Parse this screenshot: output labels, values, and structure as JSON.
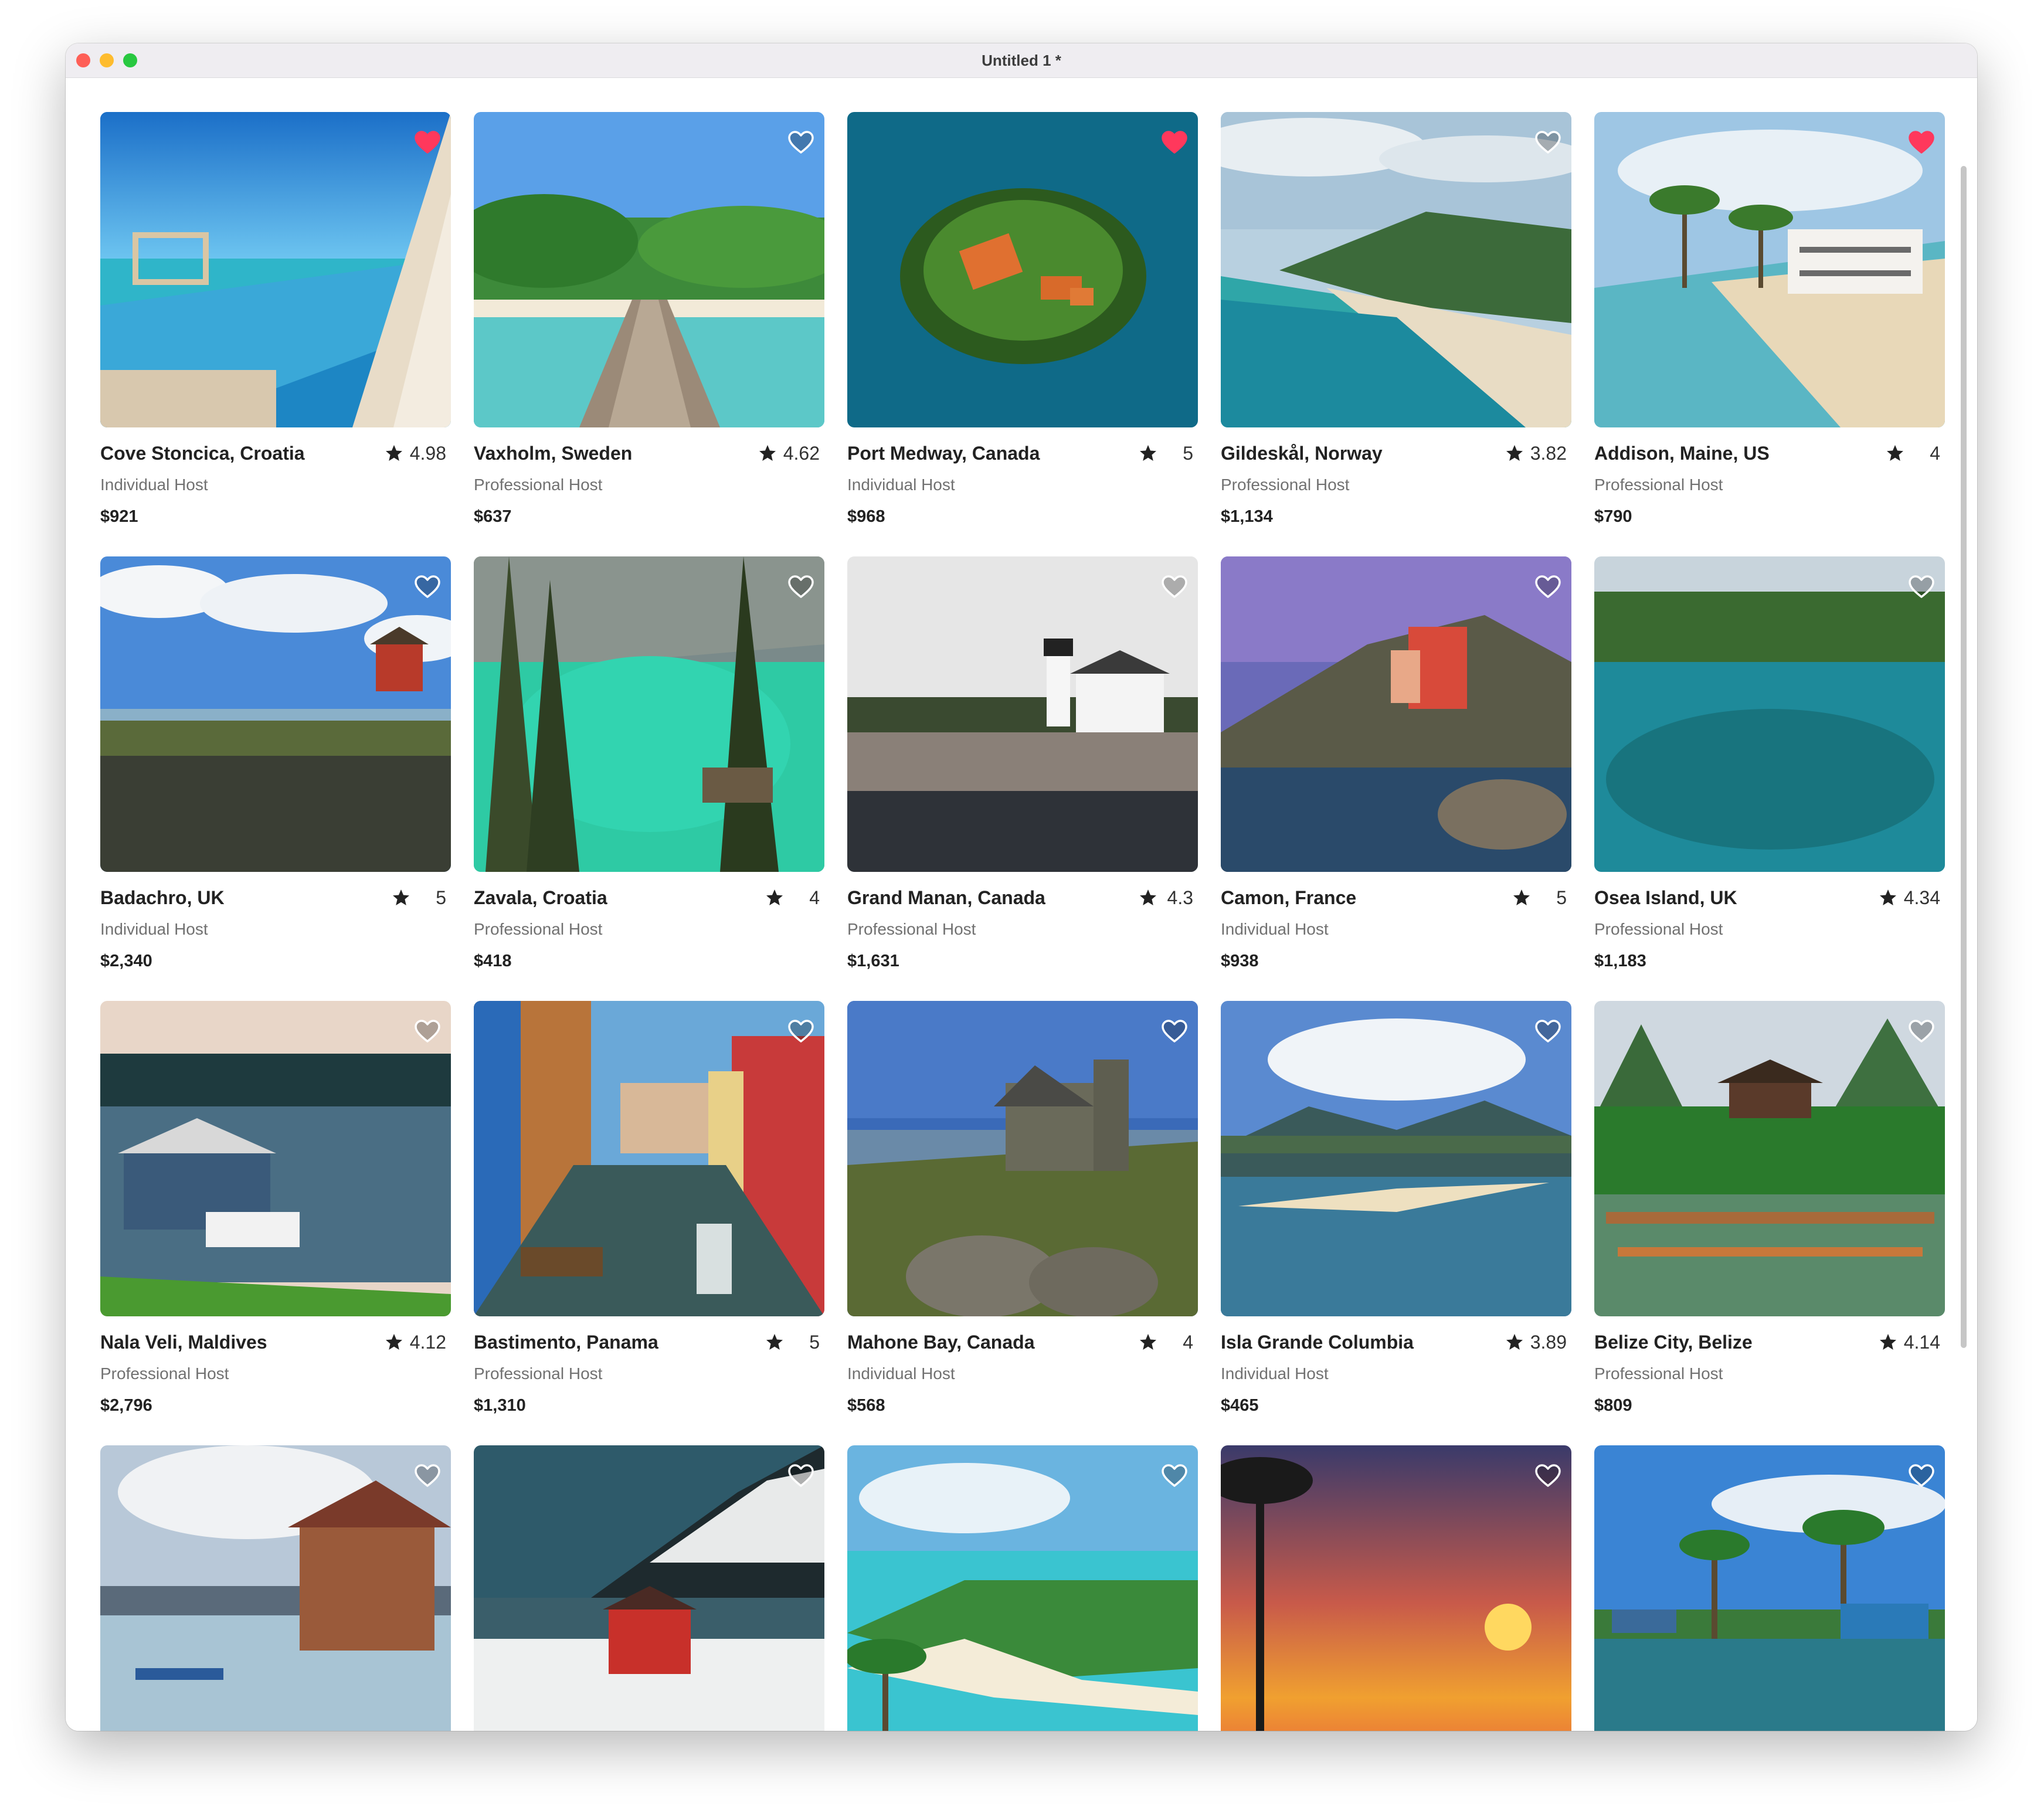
{
  "window": {
    "title": "Untitled 1 *"
  },
  "listings": [
    {
      "name": "Cove Stoncica, Croatia",
      "rating": "4.98",
      "host": "Individual Host",
      "price": "$921",
      "favorite": true,
      "image": "resort infinity pool by the sea"
    },
    {
      "name": "Vaxholm, Sweden",
      "rating": "4.62",
      "host": "Professional Host",
      "price": "$637",
      "favorite": false,
      "image": "wooden pier over turquoise water"
    },
    {
      "name": "Port Medway, Canada",
      "rating": "5",
      "host": "Individual Host",
      "price": "$968",
      "favorite": true,
      "image": "small island in deep blue water"
    },
    {
      "name": "Gildeskål, Norway",
      "rating": "3.82",
      "host": "Professional Host",
      "price": "$1,134",
      "favorite": false,
      "image": "aerial coastline with sandy beach"
    },
    {
      "name": "Addison, Maine, US",
      "rating": "4",
      "host": "Professional Host",
      "price": "$790",
      "favorite": true,
      "image": "beach villa with palm trees"
    },
    {
      "name": "Badachro, UK",
      "rating": "5",
      "host": "Individual Host",
      "price": "$2,340",
      "favorite": false,
      "image": "red hut on rocky shore"
    },
    {
      "name": "Zavala, Croatia",
      "rating": "4",
      "host": "Professional Host",
      "price": "$418",
      "favorite": false,
      "image": "emerald lake between pine trees"
    },
    {
      "name": "Grand Manan, Canada",
      "rating": "4.3",
      "host": "Professional Host",
      "price": "$1,631",
      "favorite": false,
      "image": "lighthouse on rocky coast"
    },
    {
      "name": "Camon, France",
      "rating": "5",
      "host": "Individual Host",
      "price": "$938",
      "favorite": false,
      "image": "colorful cliffside village"
    },
    {
      "name": "Osea Island, UK",
      "rating": "4.34",
      "host": "Professional Host",
      "price": "$1,183",
      "favorite": false,
      "image": "clear turquoise water and green hills"
    },
    {
      "name": "Nala Veli, Maldives",
      "rating": "4.12",
      "host": "Professional Host",
      "price": "$2,796",
      "favorite": false,
      "image": "boathouse on a lake"
    },
    {
      "name": "Bastimento, Panama",
      "rating": "5",
      "host": "Professional Host",
      "price": "$1,310",
      "favorite": false,
      "image": "canal with colorful houses and boats"
    },
    {
      "name": "Mahone Bay, Canada",
      "rating": "4",
      "host": "Individual Host",
      "price": "$568",
      "favorite": false,
      "image": "stone church by a lake"
    },
    {
      "name": "Isla Grande Columbia",
      "rating": "3.89",
      "host": "Individual Host",
      "price": "$465",
      "favorite": false,
      "image": "sandy spit with mountains"
    },
    {
      "name": "Belize City, Belize",
      "rating": "4.14",
      "host": "Professional Host",
      "price": "$809",
      "favorite": false,
      "image": "pagoda and green karst hills"
    },
    {
      "name": "",
      "rating": "",
      "host": "",
      "price": "",
      "favorite": false,
      "image": "stilt house by the sea with mountains"
    },
    {
      "name": "",
      "rating": "",
      "host": "",
      "price": "",
      "favorite": false,
      "image": "red cabin on snowy beach"
    },
    {
      "name": "",
      "rating": "",
      "host": "",
      "price": "",
      "favorite": false,
      "image": "tropical island aerial"
    },
    {
      "name": "",
      "rating": "",
      "host": "",
      "price": "",
      "favorite": false,
      "image": "sunset with palm tree"
    },
    {
      "name": "",
      "rating": "",
      "host": "",
      "price": "",
      "favorite": false,
      "image": "stilt houses and palm trees"
    }
  ],
  "colors": {
    "heart_favorite": "#ff385c",
    "heart_outline": "#ffffff",
    "star": "#222222",
    "host_text": "#717171"
  },
  "icons": {
    "favorite": "heart-icon",
    "rating": "star-icon"
  }
}
